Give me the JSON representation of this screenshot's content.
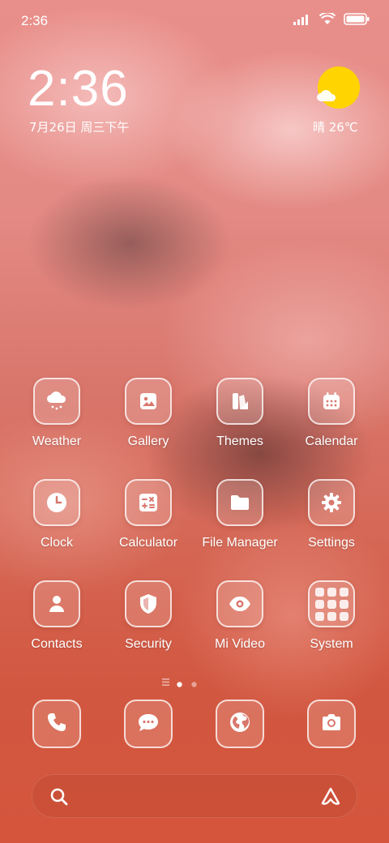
{
  "status_bar": {
    "time": "2:36",
    "icons": [
      "signal-icon",
      "wifi-icon",
      "battery-icon"
    ]
  },
  "clock_widget": {
    "time": "2:36",
    "date": "7月26日 周三下午"
  },
  "weather_widget": {
    "icon": "sun-cloud-icon",
    "text": "晴 26℃",
    "sun_color": "#ffd400"
  },
  "apps": [
    {
      "label": "Weather",
      "icon": "weather-icon"
    },
    {
      "label": "Gallery",
      "icon": "gallery-icon"
    },
    {
      "label": "Themes",
      "icon": "themes-icon"
    },
    {
      "label": "Calendar",
      "icon": "calendar-icon"
    },
    {
      "label": "Clock",
      "icon": "clock-icon"
    },
    {
      "label": "Calculator",
      "icon": "calculator-icon"
    },
    {
      "label": "File Manager",
      "icon": "folder-icon"
    },
    {
      "label": "Settings",
      "icon": "gear-icon"
    },
    {
      "label": "Contacts",
      "icon": "contacts-icon"
    },
    {
      "label": "Security",
      "icon": "shield-icon"
    },
    {
      "label": "Mi Video",
      "icon": "eye-icon"
    },
    {
      "label": "System",
      "icon": "folder-grid-icon"
    }
  ],
  "pager": {
    "pages": 3,
    "current": 2
  },
  "dock": [
    {
      "icon": "phone-icon"
    },
    {
      "icon": "messages-icon"
    },
    {
      "icon": "browser-icon"
    },
    {
      "icon": "camera-icon"
    }
  ],
  "search_bar": {
    "left_icon": "search-icon",
    "right_icon": "assistant-icon"
  }
}
